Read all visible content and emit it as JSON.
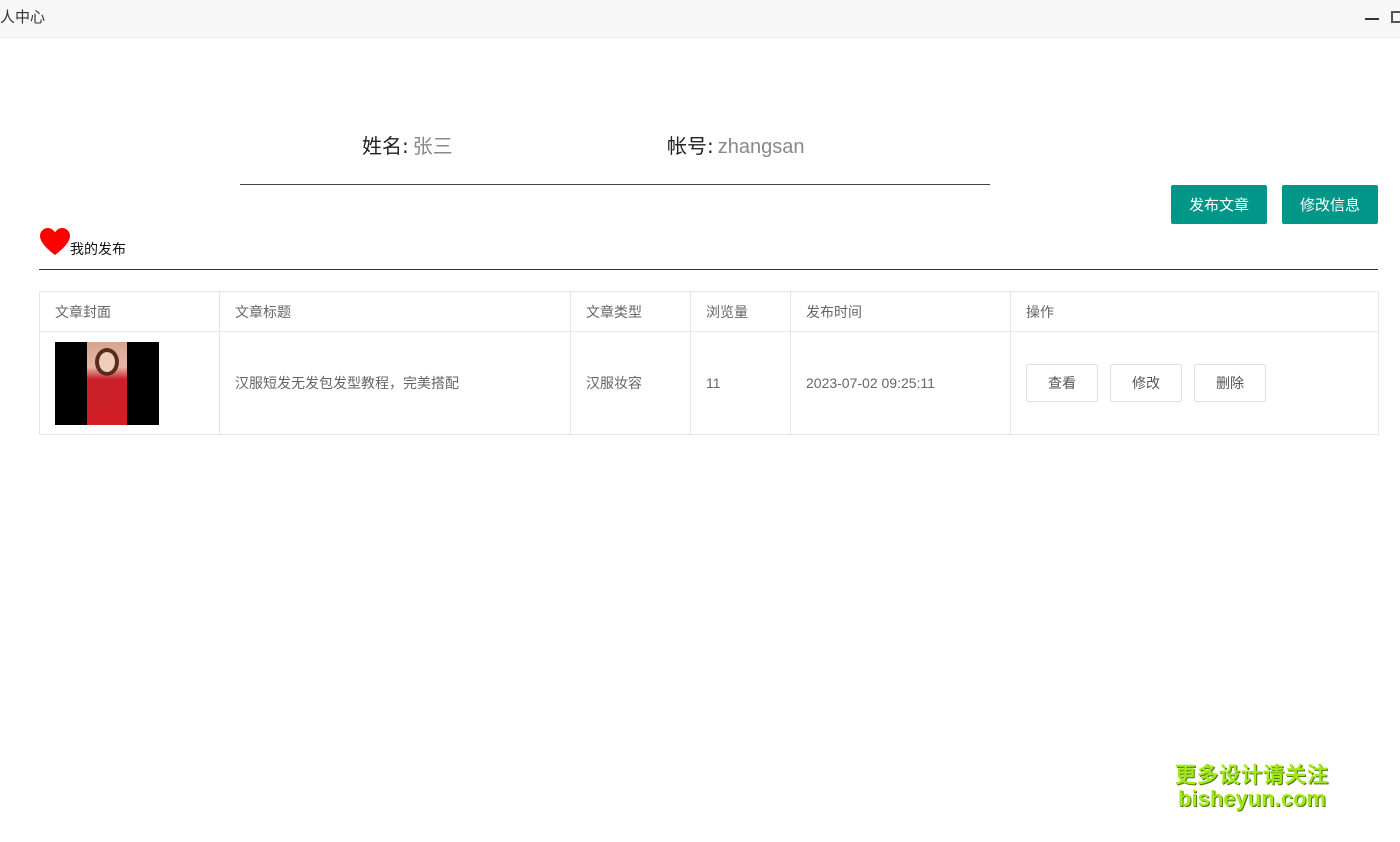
{
  "window": {
    "title": "人中心"
  },
  "profile": {
    "name_label": "姓名:",
    "name_value": "张三",
    "account_label": "帐号:",
    "account_value": "zhangsan"
  },
  "actions": {
    "publish_label": "发布文章",
    "edit_info_label": "修改信息"
  },
  "section": {
    "title": "我的发布",
    "icon": "heart-icon",
    "icon_color": "#ff0000"
  },
  "table": {
    "columns": [
      "文章封面",
      "文章标题",
      "文章类型",
      "浏览量",
      "发布时间",
      "操作"
    ],
    "rows": [
      {
        "title": "汉服短发无发包发型教程，完美搭配",
        "type": "汉服妆容",
        "views": "11",
        "published": "2023-07-02 09:25:11",
        "ops": {
          "view": "查看",
          "edit": "修改",
          "delete": "删除"
        }
      }
    ]
  },
  "watermark": {
    "line1": "更多设计请关注",
    "line2": "bisheyun.com"
  },
  "colors": {
    "primary": "#009688",
    "watermark": "#a3e81d"
  }
}
